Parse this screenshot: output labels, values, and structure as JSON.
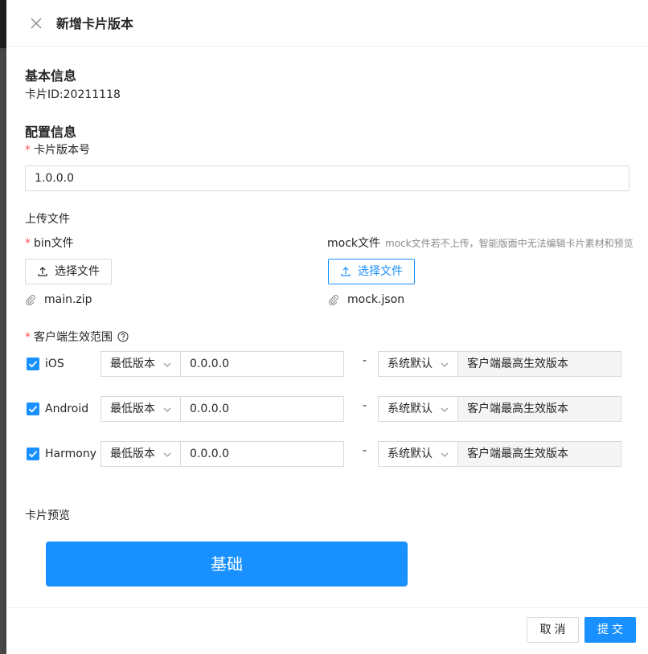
{
  "drawer": {
    "title": "新增卡片版本"
  },
  "basic": {
    "title": "基本信息",
    "card_id_text": "卡片ID:20211118"
  },
  "config": {
    "title": "配置信息",
    "version_label": "卡片版本号",
    "version_value": "1.0.0.0"
  },
  "upload": {
    "title": "上传文件",
    "bin": {
      "label": "bin文件",
      "button_label": "选择文件",
      "file_name": "main.zip"
    },
    "mock": {
      "label": "mock文件",
      "hint": "mock文件若不上传，智能版面中无法编辑卡片素材和预览",
      "button_label": "选择文件",
      "file_name": "mock.json"
    }
  },
  "client_range": {
    "label": "客户端生效范围",
    "platforms": [
      {
        "name": "iOS",
        "checked": true,
        "min_select": "最低版本",
        "min_version": "0.0.0.0",
        "dash": "-",
        "max_select": "系统默认",
        "max_placeholder": "客户端最高生效版本"
      },
      {
        "name": "Android",
        "checked": true,
        "min_select": "最低版本",
        "min_version": "0.0.0.0",
        "dash": "-",
        "max_select": "系统默认",
        "max_placeholder": "客户端最高生效版本"
      },
      {
        "name": "Harmony",
        "checked": true,
        "min_select": "最低版本",
        "min_version": "0.0.0.0",
        "dash": "-",
        "max_select": "系统默认",
        "max_placeholder": "客户端最高生效版本"
      }
    ]
  },
  "preview": {
    "title": "卡片预览",
    "button_label": "基础"
  },
  "footer": {
    "cancel_label": "取消",
    "submit_label": "提交"
  },
  "colors": {
    "primary": "#1890ff",
    "required": "#ff4d4f"
  },
  "icons": {
    "close": "close-icon",
    "upload": "upload-icon",
    "attachment": "paperclip-icon",
    "help": "question-circle-icon",
    "check": "check-icon",
    "chevron": "chevron-down-icon"
  }
}
